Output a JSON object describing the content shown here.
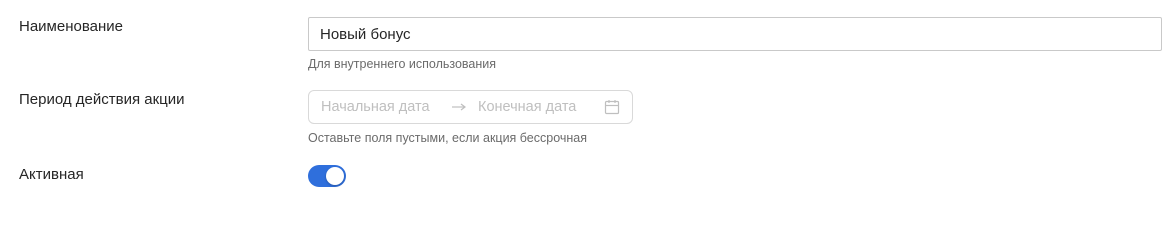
{
  "fields": {
    "name": {
      "label": "Наименование",
      "value": "Новый бонус",
      "hint": "Для внутреннего использования"
    },
    "period": {
      "label": "Период действия акции",
      "start_placeholder": "Начальная дата",
      "end_placeholder": "Конечная дата",
      "separator_icon": "arrow-right-icon",
      "calendar_icon": "calendar-icon",
      "hint": "Оставьте поля пустыми, если акция бессрочная"
    },
    "active": {
      "label": "Активная",
      "checked": true
    }
  },
  "colors": {
    "toggle_on": "#2f6fdc",
    "input_border": "#c9c9c9",
    "placeholder": "#bfbfbf",
    "hint_text": "#6b6b6b"
  }
}
